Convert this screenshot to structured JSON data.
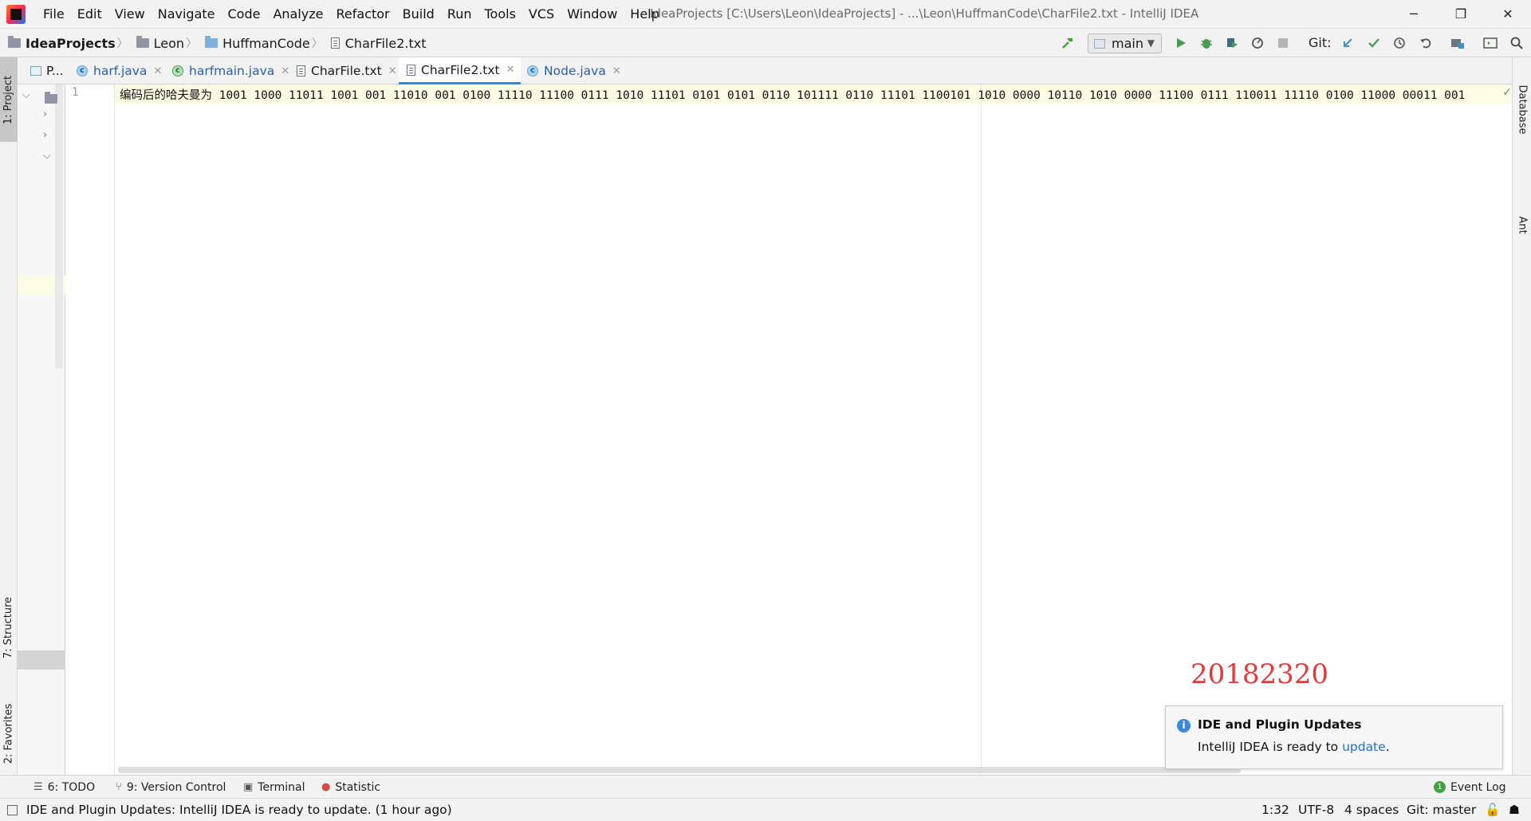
{
  "window": {
    "title": "IdeaProjects [C:\\Users\\Leon\\IdeaProjects] - ...\\Leon\\HuffmanCode\\CharFile2.txt - IntelliJ IDEA",
    "controls": {
      "minimize": "─",
      "restore": "❐",
      "close": "✕"
    }
  },
  "menu": [
    "File",
    "Edit",
    "View",
    "Navigate",
    "Code",
    "Analyze",
    "Refactor",
    "Build",
    "Run",
    "Tools",
    "VCS",
    "Window",
    "Help"
  ],
  "breadcrumb": [
    "IdeaProjects",
    "Leon",
    "HuffmanCode",
    "CharFile2.txt"
  ],
  "toolbar": {
    "run_config": "main",
    "git_label": "Git:",
    "icons": [
      "hammer-icon",
      "run-icon",
      "debug-icon",
      "coverage-icon",
      "profile-icon",
      "stop-icon",
      "vcs-update-icon",
      "vcs-commit-icon",
      "history-icon",
      "revert-icon",
      "project-structure-icon",
      "terminal-icon",
      "search-icon"
    ]
  },
  "left_tools": {
    "project": "1: Project",
    "structure": "7: Structure",
    "favorites": "2: Favorites"
  },
  "right_tools": {
    "database": "Database",
    "ant": "Ant"
  },
  "tabs": [
    {
      "label": "P...",
      "icon": "project-icon"
    },
    {
      "label": "harf.java",
      "icon": "class-icon"
    },
    {
      "label": "harfmain.java",
      "icon": "main-class-icon"
    },
    {
      "label": "CharFile.txt",
      "icon": "text-file-icon"
    },
    {
      "label": "CharFile2.txt",
      "icon": "text-file-icon",
      "active": true
    },
    {
      "label": "Node.java",
      "icon": "class-icon"
    }
  ],
  "editor": {
    "line_number": "1",
    "line_text": "编码后的哈夫曼为 1001 1000 11011 1001 001 11010 001 0100 11110 11100 0111 1010 11101 0101 0101 0110 101111 0110 11101 1100101 1010 0000 10110 1010 0000 11100 0111 110011 11110 0100 11000 00011 001"
  },
  "watermark": "20182320",
  "notification": {
    "title": "IDE and Plugin Updates",
    "body": "IntelliJ IDEA is ready to ",
    "link": "update",
    "suffix": "."
  },
  "bottom_tools": {
    "todo": "6: TODO",
    "version_control": "9: Version Control",
    "terminal": "Terminal",
    "statistic": "Statistic",
    "event_log": "Event Log",
    "event_log_count": "1"
  },
  "status": {
    "message": "IDE and Plugin Updates: IntelliJ IDEA is ready to update. (1 hour ago)",
    "position": "1:32",
    "encoding": "UTF-8",
    "indent": "4 spaces",
    "git": "Git: master"
  }
}
